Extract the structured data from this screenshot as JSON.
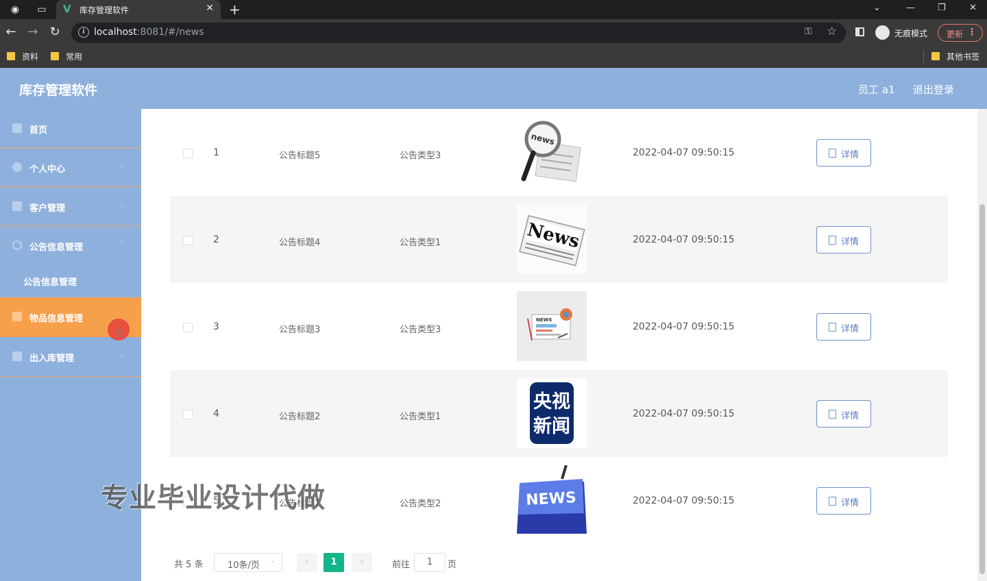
{
  "browser": {
    "tab_title": "库存管理软件",
    "url_host": "localhost",
    "url_rest": ":8081/#/news",
    "incognito_label": "无痕模式",
    "update_label": "更新",
    "bookmarks": [
      "资料",
      "常用"
    ],
    "other_bookmarks": "其他书签"
  },
  "header": {
    "title": "库存管理软件",
    "user": "员工 a1",
    "logout": "退出登录"
  },
  "sidebar": {
    "items": [
      {
        "label": "首页",
        "icon": "home-icon"
      },
      {
        "label": "个人中心",
        "icon": "user-icon"
      },
      {
        "label": "客户管理",
        "icon": "grid-icon"
      },
      {
        "label": "公告信息管理",
        "icon": "bell-icon"
      },
      {
        "label": "公告信息管理",
        "icon": "none"
      },
      {
        "label": "物品信息管理",
        "icon": "goods-icon"
      },
      {
        "label": "出入库管理",
        "icon": "warehouse-icon"
      }
    ],
    "active_index": 5
  },
  "table": {
    "rows": [
      {
        "index": "1",
        "title": "公告标题5",
        "type": "公告类型3",
        "time": "2022-04-07 09:50:15",
        "image": "news-magnifier-image"
      },
      {
        "index": "2",
        "title": "公告标题4",
        "type": "公告类型1",
        "time": "2022-04-07 09:50:15",
        "image": "news-newspaper-image"
      },
      {
        "index": "3",
        "title": "公告标题3",
        "type": "公告类型3",
        "time": "2022-04-07 09:50:15",
        "image": "news-card-image"
      },
      {
        "index": "4",
        "title": "公告标题2",
        "type": "公告类型1",
        "time": "2022-04-07 09:50:15",
        "image": "cctv-news-image"
      },
      {
        "index": "5",
        "title": "公告标题1",
        "type": "公告类型2",
        "time": "2022-04-07 09:50:15",
        "image": "news-key-image"
      }
    ],
    "detail_label": "详情"
  },
  "watermark": "专业毕业设计代做",
  "pagination": {
    "total": "共 5 条",
    "page_size": "10条/页",
    "current": "1",
    "goto_label": "前往",
    "goto_value": "1",
    "unit": "页"
  },
  "images": {
    "magnifier_text": "news",
    "newspaper_text": "News",
    "card_text": "NEWS",
    "cctv_line1": "央视",
    "cctv_line2": "新闻",
    "key_text": "NEWS"
  },
  "colors": {
    "header_bg": "#8eb0dc",
    "active_menu": "#f7a04c",
    "page_current": "#13b58a",
    "detail_border": "#6f8fcc"
  }
}
